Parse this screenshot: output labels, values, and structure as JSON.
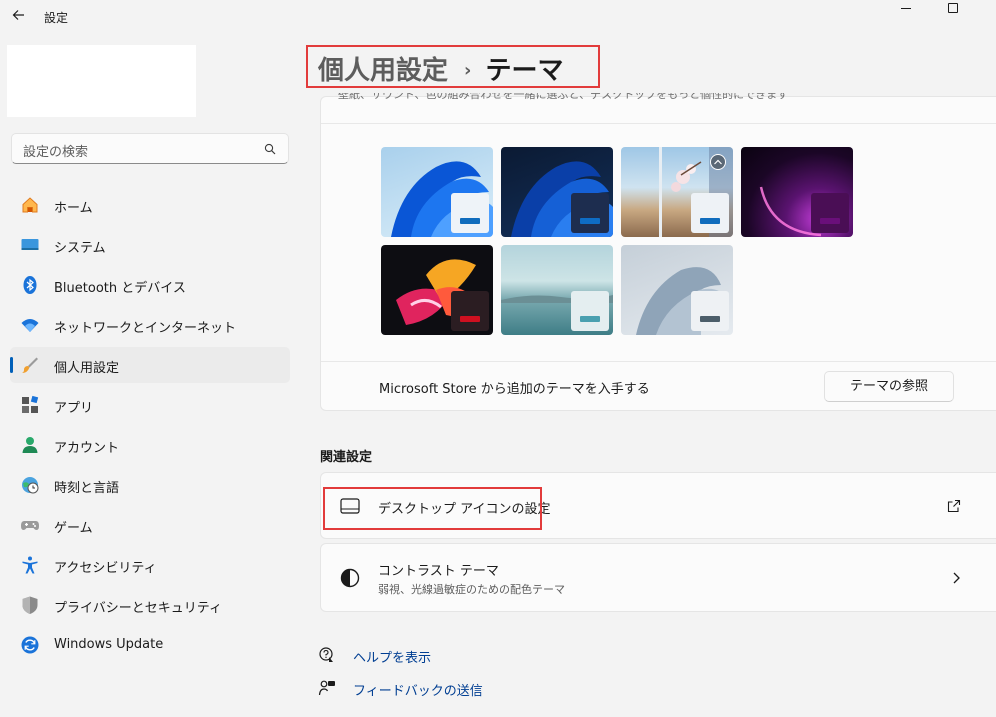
{
  "app": {
    "title": "設定"
  },
  "search": {
    "placeholder": "設定の検索"
  },
  "sidebar": {
    "items": [
      {
        "label": "ホーム",
        "icon": "home-icon",
        "active": false
      },
      {
        "label": "システム",
        "icon": "system-icon",
        "active": false
      },
      {
        "label": "Bluetooth とデバイス",
        "icon": "bluetooth-icon",
        "active": false
      },
      {
        "label": "ネットワークとインターネット",
        "icon": "wifi-icon",
        "active": false
      },
      {
        "label": "個人用設定",
        "icon": "brush-icon",
        "active": true
      },
      {
        "label": "アプリ",
        "icon": "apps-icon",
        "active": false
      },
      {
        "label": "アカウント",
        "icon": "account-icon",
        "active": false
      },
      {
        "label": "時刻と言語",
        "icon": "globe-clock-icon",
        "active": false
      },
      {
        "label": "ゲーム",
        "icon": "gamepad-icon",
        "active": false
      },
      {
        "label": "アクセシビリティ",
        "icon": "accessibility-icon",
        "active": false
      },
      {
        "label": "プライバシーとセキュリティ",
        "icon": "shield-icon",
        "active": false
      },
      {
        "label": "Windows Update",
        "icon": "update-icon",
        "active": false
      }
    ]
  },
  "header": {
    "parent": "個人用設定",
    "separator": "›",
    "current": "テーマ"
  },
  "themes": {
    "description": "壁紙、サウンド、色の組み合わせを一緒に選ぶと、デスクトップをもっと個性的にできます",
    "store_text": "Microsoft Store から追加のテーマを入手する",
    "browse_label": "テーマの参照",
    "accent_colors": [
      "#0f6cbd",
      "#0e6cc4",
      "#0f6cbd",
      "#6a0f7a",
      "#cf1020",
      "#4aa0b0",
      "#4c5e6a"
    ]
  },
  "related": {
    "title": "関連設定",
    "desktop_icons": "デスクトップ アイコンの設定",
    "contrast_title": "コントラスト テーマ",
    "contrast_sub": "弱視、光線過敏症のための配色テーマ"
  },
  "links": {
    "help": "ヘルプを表示",
    "feedback": "フィードバックの送信"
  }
}
